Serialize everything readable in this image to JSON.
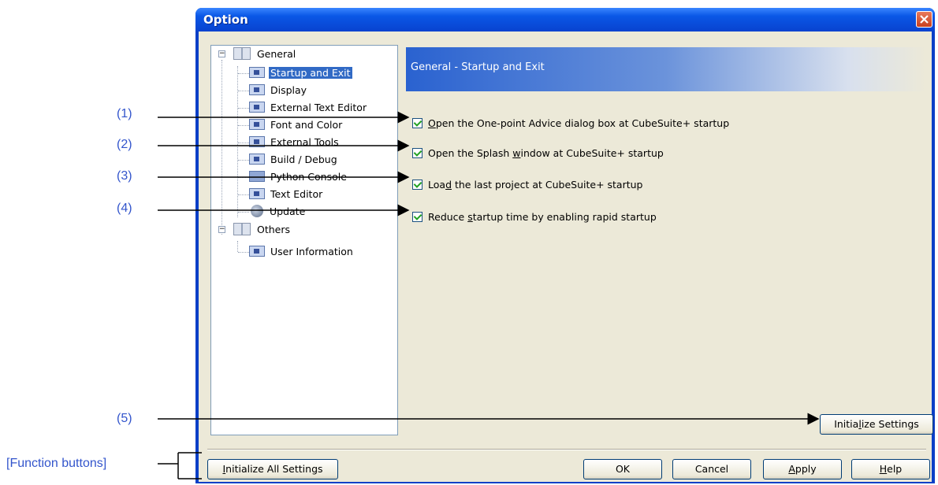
{
  "dialog": {
    "title": "Option",
    "close_glyph": "✕"
  },
  "tree": {
    "items": [
      {
        "label": "General",
        "icon": "book-icon",
        "level": 0,
        "expander": "−"
      },
      {
        "label": "Startup and Exit",
        "icon": "page-icon",
        "level": 1,
        "selected": true
      },
      {
        "label": "Display",
        "icon": "page-icon",
        "level": 1
      },
      {
        "label": "External Text Editor",
        "icon": "page-icon",
        "level": 1
      },
      {
        "label": "Font and Color",
        "icon": "page-icon",
        "level": 1
      },
      {
        "label": "External Tools",
        "icon": "page-icon",
        "level": 1
      },
      {
        "label": "Build / Debug",
        "icon": "page-icon",
        "level": 1
      },
      {
        "label": "Python Console",
        "icon": "python-icon",
        "level": 1
      },
      {
        "label": "Text Editor",
        "icon": "page-icon",
        "level": 1
      },
      {
        "label": "Update",
        "icon": "update-icon",
        "level": 1
      },
      {
        "label": "Others",
        "icon": "book-icon",
        "level": 0,
        "expander": "−"
      },
      {
        "label": "User Information",
        "icon": "page-icon",
        "level": 1
      }
    ]
  },
  "panel": {
    "header": "General - Startup and Exit",
    "options": [
      {
        "pre": "",
        "key": "O",
        "post": "pen the One-point Advice dialog box at CubeSuite+ startup",
        "checked": true
      },
      {
        "pre": "Open the Splash ",
        "key": "w",
        "post": "indow at CubeSuite+ startup",
        "checked": true
      },
      {
        "pre": "Loa",
        "key": "d",
        "post": " the last project at CubeSuite+ startup",
        "checked": true
      },
      {
        "pre": "Reduce ",
        "key": "s",
        "post": "tartup time by enabling rapid startup",
        "checked": true
      }
    ],
    "init_settings": {
      "pre": "Initia",
      "key": "l",
      "post": "ize Settings"
    }
  },
  "buttons": {
    "init_all": {
      "pre": "",
      "key": "I",
      "post": "nitialize All Settings"
    },
    "ok": {
      "pre": "OK",
      "key": "",
      "post": ""
    },
    "cancel": {
      "pre": "Cancel",
      "key": "",
      "post": ""
    },
    "apply": {
      "pre": "",
      "key": "A",
      "post": "pply"
    },
    "help": {
      "pre": "",
      "key": "H",
      "post": "elp"
    }
  },
  "callouts": [
    "(1)",
    "(2)",
    "(3)",
    "(4)",
    "(5)",
    "[Function buttons]"
  ],
  "colors": {
    "callout": "#3355cc",
    "title_bar": "#0a57e6",
    "selection": "#316ac5"
  }
}
